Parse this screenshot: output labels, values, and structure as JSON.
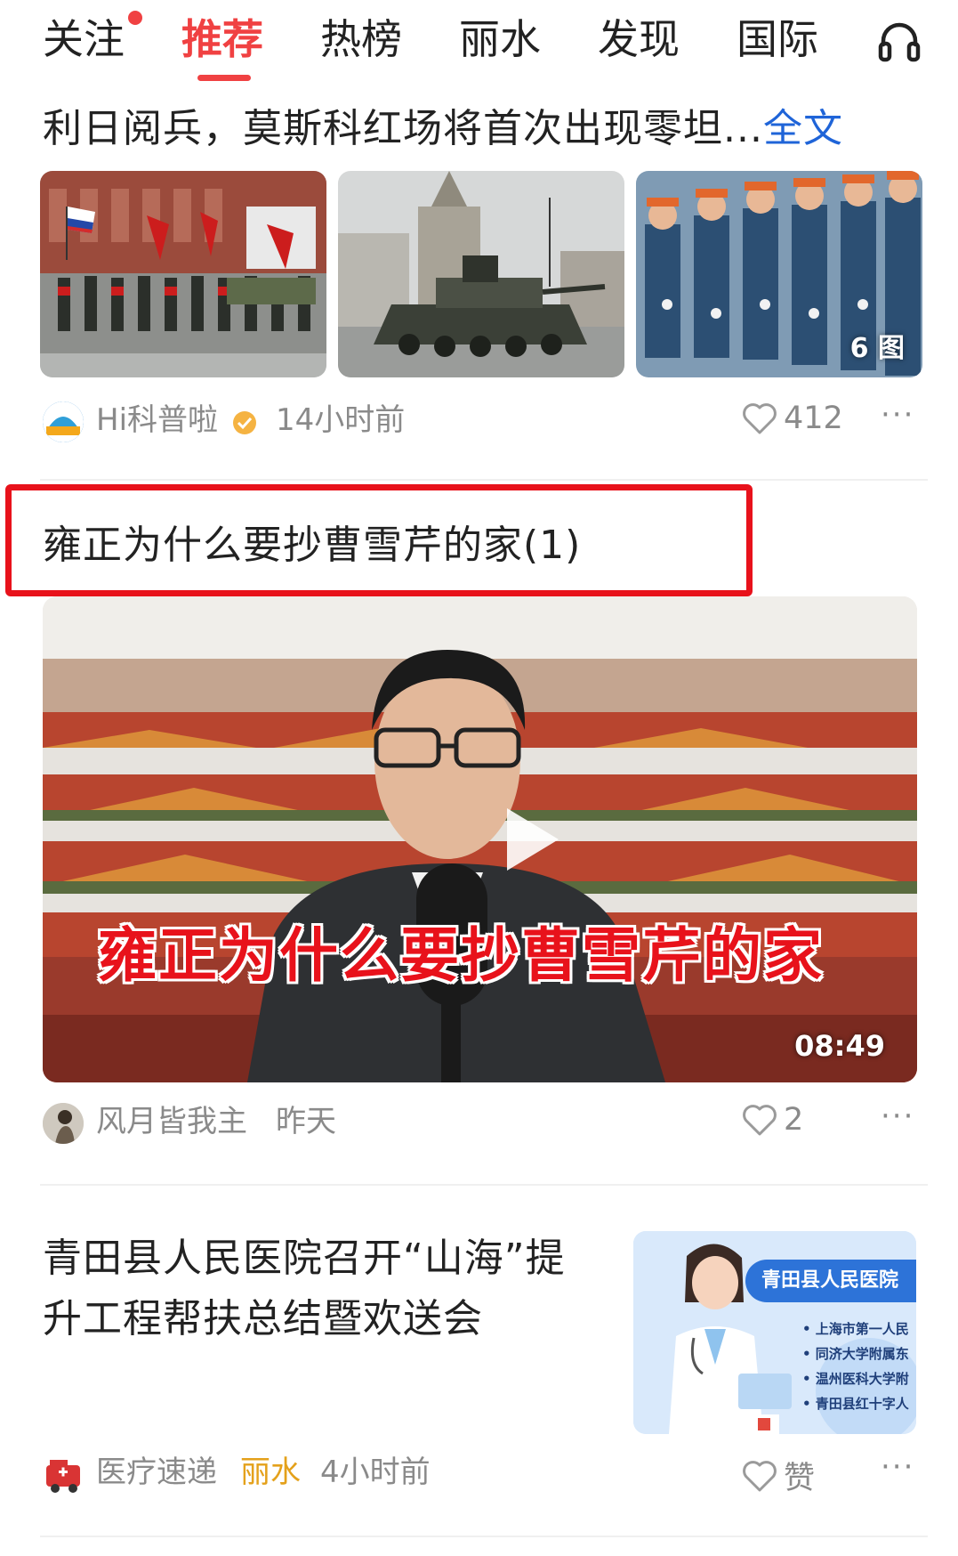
{
  "tabs": [
    {
      "label": "关注"
    },
    {
      "label": "推荐"
    },
    {
      "label": "热榜"
    },
    {
      "label": "丽水"
    },
    {
      "label": "发现"
    },
    {
      "label": "国际"
    }
  ],
  "tab_active_index": 1,
  "icons": {
    "headphone": "headphone-icon",
    "heart": "heart-icon",
    "more": "more-dots-icon",
    "verified": "verified-badge-icon",
    "play": "play-icon"
  },
  "colors": {
    "accent": "#f04142",
    "link": "#1f64d8",
    "highlight": "#e8121b",
    "location": "#e4a11b",
    "meta": "#8a8a8a"
  },
  "card1": {
    "title_text": "利日阅兵，莫斯科红场将首次出现零坦...",
    "full_link": "全文",
    "image_count": "6 图",
    "author": "Hi科普啦",
    "time": "14小时前",
    "likes": "412",
    "more": "···"
  },
  "card2": {
    "title": "雍正为什么要抄曹雪芹的家(1)",
    "video_caption": "雍正为什么要抄曹雪芹的家",
    "duration": "08:49",
    "author": "风月皆我主",
    "time": "昨天",
    "likes": "2",
    "more": "···"
  },
  "card3": {
    "title_line1": "青田县人民医院召开“山海”提",
    "title_line2": "升工程帮扶总结暨欢送会",
    "thumb_badge": "青田县人民医院",
    "thumb_bullets": [
      "• 上海市第一人民",
      "• 同济大学附属东",
      "• 温州医科大学附",
      "• 青田县红十字人"
    ],
    "author": "医疗速递",
    "location": "丽水",
    "time": "4小时前",
    "likes": "赞",
    "more": "···"
  }
}
